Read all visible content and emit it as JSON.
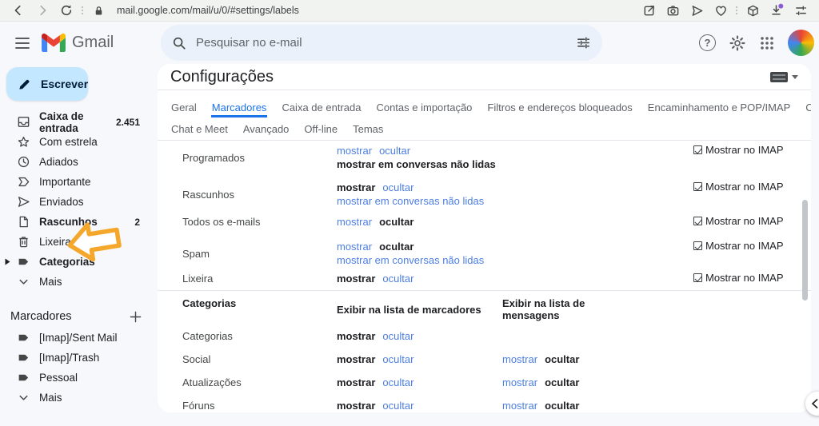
{
  "browser": {
    "url": "mail.google.com/mail/u/0/#settings/labels",
    "left_icons": [
      "back-icon",
      "forward-icon",
      "reload-icon",
      "lock-icon"
    ],
    "right_icons": [
      "share-edit-icon",
      "camera-icon",
      "send-icon",
      "heart-icon",
      "cube-icon",
      "download-icon",
      "tune-icon"
    ],
    "download_badge_color": "#8e5bd6"
  },
  "header": {
    "app_name": "Gmail",
    "search": {
      "placeholder": "Pesquisar no e-mail"
    },
    "right_icons": [
      "help-icon",
      "settings-gear-icon",
      "apps-grid-icon",
      "avatar"
    ]
  },
  "sidebar": {
    "compose": {
      "label": "Escrever",
      "icon": "pencil-icon",
      "bg": "#c2e7ff"
    },
    "items": [
      {
        "label": "Caixa de entrada",
        "count": "2.451",
        "style": "bold",
        "icon": "inbox-icon"
      },
      {
        "label": "Com estrela",
        "count": "",
        "style": "",
        "icon": "star-icon"
      },
      {
        "label": "Adiados",
        "count": "",
        "style": "",
        "icon": "clock-icon"
      },
      {
        "label": "Importante",
        "count": "",
        "style": "",
        "icon": "important-icon"
      },
      {
        "label": "Enviados",
        "count": "",
        "style": "",
        "icon": "send-icon"
      },
      {
        "label": "Rascunhos",
        "count": "2",
        "style": "bold",
        "icon": "draft-icon"
      },
      {
        "label": "Lixeira",
        "count": "",
        "style": "",
        "icon": "trash-icon"
      },
      {
        "label": "Categorias",
        "count": "",
        "style": "bold",
        "icon": "label-icon"
      },
      {
        "label": "Mais",
        "count": "",
        "style": "",
        "icon": "chevron-down-icon"
      }
    ],
    "labels_section": {
      "title": "Marcadores",
      "add_icon": "plus-icon",
      "items": [
        {
          "label": "[Imap]/Sent Mail",
          "icon": "label-icon"
        },
        {
          "label": "[Imap]/Trash",
          "icon": "label-icon"
        },
        {
          "label": "Pessoal",
          "icon": "label-icon"
        },
        {
          "label": "Mais",
          "icon": "chevron-down-icon"
        }
      ]
    }
  },
  "annotation": {
    "shape": "left-arrow",
    "color": "#F5A72C",
    "target": "Lixeira"
  },
  "settings": {
    "title": "Configurações",
    "input_tool_icon": "keyboard-icon",
    "tabs": [
      {
        "label": "Geral",
        "style": ""
      },
      {
        "label": "Marcadores",
        "style": "active"
      },
      {
        "label": "Caixa de entrada",
        "style": ""
      },
      {
        "label": "Contas e importação",
        "style": ""
      },
      {
        "label": "Filtros e endereços bloqueados",
        "style": ""
      },
      {
        "label": "Encaminhamento e POP/IMAP",
        "style": ""
      },
      {
        "label": "Complementos",
        "style": ""
      },
      {
        "label": "Chat e Meet",
        "style": ""
      },
      {
        "label": "Avançado",
        "style": ""
      },
      {
        "label": "Off-line",
        "style": ""
      },
      {
        "label": "Temas",
        "style": ""
      }
    ],
    "rows": [
      {
        "name": "Programados",
        "show": {
          "text": "mostrar",
          "style": "link"
        },
        "hide": {
          "text": "ocultar",
          "style": "link"
        },
        "line2": {
          "text": "mostrar em conversas não lidas",
          "style": "selected"
        },
        "imap": "Mostrar no IMAP"
      },
      {
        "name": "Rascunhos",
        "show": {
          "text": "mostrar",
          "style": "selected"
        },
        "hide": {
          "text": "ocultar",
          "style": "link"
        },
        "line2": {
          "text": "mostrar em conversas não lidas",
          "style": "link"
        },
        "imap": "Mostrar no IMAP"
      },
      {
        "name": "Todos os e-mails",
        "show": {
          "text": "mostrar",
          "style": "link"
        },
        "hide": {
          "text": "ocultar",
          "style": "selected"
        },
        "imap": "Mostrar no IMAP"
      },
      {
        "name": "Spam",
        "show": {
          "text": "mostrar",
          "style": "link"
        },
        "hide": {
          "text": "ocultar",
          "style": "selected"
        },
        "line2": {
          "text": "mostrar em conversas não lidas",
          "style": "link"
        },
        "imap": "Mostrar no IMAP"
      },
      {
        "name": "Lixeira",
        "show": {
          "text": "mostrar",
          "style": "selected"
        },
        "hide": {
          "text": "ocultar",
          "style": "link"
        },
        "imap": "Mostrar no IMAP"
      }
    ],
    "categories": {
      "col1_header": "Categorias",
      "col2_header": "Exibir na lista de marcadores",
      "col3_header": "Exibir na lista de mensagens",
      "rows": [
        {
          "name": "Categorias",
          "show": {
            "text": "mostrar",
            "style": "selected"
          },
          "hide": {
            "text": "ocultar",
            "style": "link"
          }
        },
        {
          "name": "Social",
          "show": {
            "text": "mostrar",
            "style": "selected"
          },
          "hide": {
            "text": "ocultar",
            "style": "link"
          },
          "show2": {
            "text": "mostrar",
            "style": "link"
          },
          "hide2": {
            "text": "ocultar",
            "style": "selected"
          }
        },
        {
          "name": "Atualizações",
          "show": {
            "text": "mostrar",
            "style": "selected"
          },
          "hide": {
            "text": "ocultar",
            "style": "link"
          },
          "show2": {
            "text": "mostrar",
            "style": "link"
          },
          "hide2": {
            "text": "ocultar",
            "style": "selected"
          }
        },
        {
          "name": "Fóruns",
          "show": {
            "text": "mostrar",
            "style": "selected"
          },
          "hide": {
            "text": "ocultar",
            "style": "link"
          },
          "show2": {
            "text": "mostrar",
            "style": "link"
          },
          "hide2": {
            "text": "ocultar",
            "style": "selected"
          }
        }
      ]
    }
  }
}
